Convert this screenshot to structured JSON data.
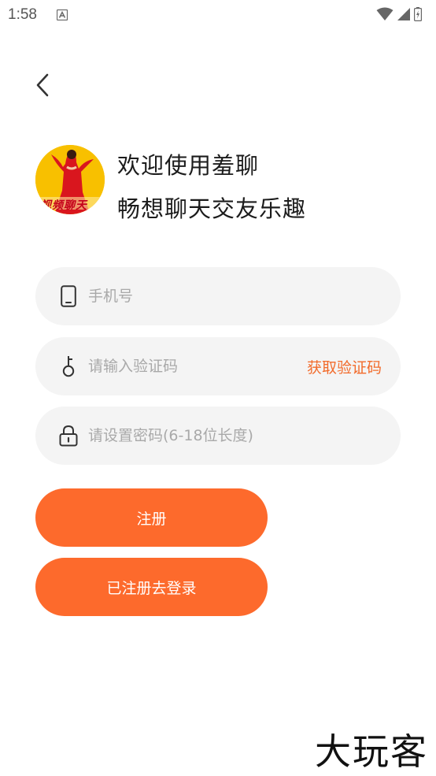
{
  "status_bar": {
    "time": "1:58"
  },
  "welcome": {
    "line1": "欢迎使用羞聊",
    "line2": "畅想聊天交友乐趣",
    "logo_text": "视频聊天"
  },
  "form": {
    "phone": {
      "value": "",
      "placeholder": "手机号"
    },
    "code": {
      "value": "",
      "placeholder": "请输入验证码",
      "action_label": "获取验证码"
    },
    "password": {
      "value": "",
      "placeholder": "请设置密码(6-18位长度)"
    }
  },
  "buttons": {
    "register": "注册",
    "go_login": "已注册去登录"
  },
  "watermark": "大玩客",
  "colors": {
    "accent": "#fd6a2c",
    "field_bg": "#f4f4f4",
    "placeholder": "#a9a9a9"
  }
}
